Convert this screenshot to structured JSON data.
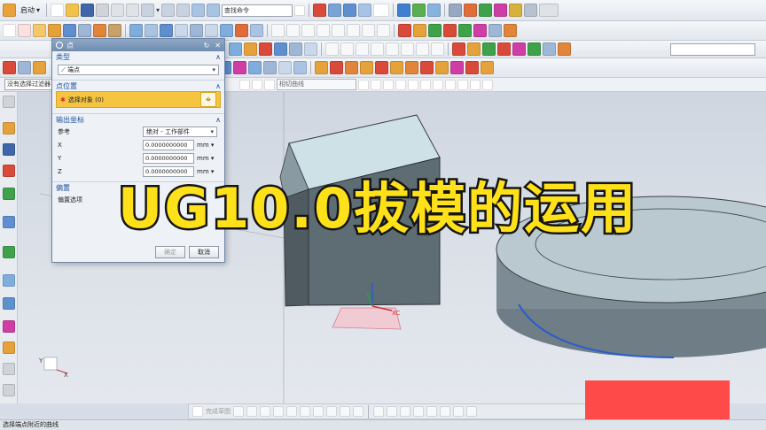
{
  "toolbar": {
    "start_label": "启动",
    "command_search_placeholder": "查找命令",
    "selection_filter": "没有选择过滤器",
    "curve_rule": "相切曲线"
  },
  "dialog": {
    "title": "点",
    "type_section": "类型",
    "type_value": "端点",
    "location_section": "点位置",
    "select_object": "选择对象 (0)",
    "output_section": "输出坐标",
    "reference_label": "参考",
    "reference_value": "绝对 - 工作部件",
    "x_label": "X",
    "y_label": "Y",
    "z_label": "Z",
    "x_value": "0.0000000000",
    "y_value": "0.0000000000",
    "z_value": "0.0000000000",
    "unit": "mm",
    "offset_section": "偏置",
    "offset_option": "偏置选项",
    "ok_label": "确定",
    "cancel_label": "取消"
  },
  "overlay_title": "UG10.0拔模的运用",
  "status_text": "选择端点附近的曲线",
  "bottom_toolbar": {
    "snap_label": "完成草图"
  },
  "scene": {
    "wcs_label": "XC",
    "axis_x_label": "X",
    "axis_y_label": "Y"
  }
}
